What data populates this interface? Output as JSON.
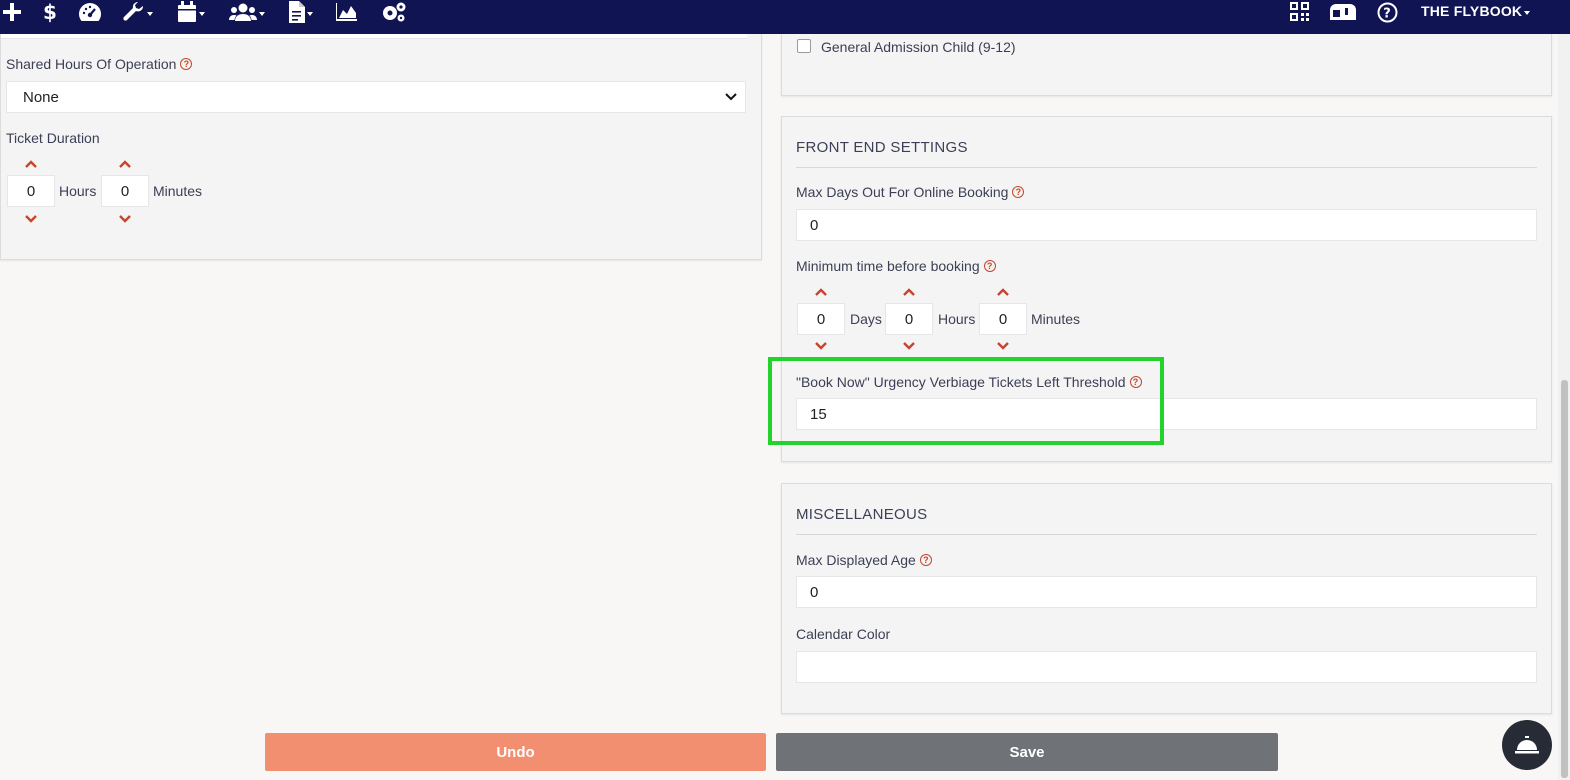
{
  "nav": {
    "brand": "THE FLYBOOK",
    "icons": [
      "plus-icon",
      "dollar-icon",
      "dashboard-icon",
      "wrench-icon",
      "calendar-icon",
      "users-icon",
      "document-icon",
      "chart-icon",
      "settings-icon",
      "qr-code-icon",
      "mailbox-icon",
      "help-icon"
    ]
  },
  "left_panel": {
    "shared_hours_label": "Shared Hours Of Operation",
    "shared_hours_value": "None",
    "ticket_duration_label": "Ticket Duration",
    "duration_hours": "0",
    "duration_hours_unit": "Hours",
    "duration_minutes": "0",
    "duration_minutes_unit": "Minutes"
  },
  "top_right_panel": {
    "checkbox_label": "General Admission Child (9-12)"
  },
  "front_end": {
    "title": "FRONT END SETTINGS",
    "max_days_label": "Max Days Out For Online Booking",
    "max_days_value": "0",
    "min_time_label": "Minimum time before booking",
    "min_days": "0",
    "min_days_unit": "Days",
    "min_hours": "0",
    "min_hours_unit": "Hours",
    "min_minutes": "0",
    "min_minutes_unit": "Minutes",
    "threshold_label": "\"Book Now\" Urgency Verbiage Tickets Left Threshold",
    "threshold_value": "15"
  },
  "misc": {
    "title": "MISCELLANEOUS",
    "max_age_label": "Max Displayed Age",
    "max_age_value": "0",
    "calendar_color_label": "Calendar Color",
    "calendar_color_value": ""
  },
  "actions": {
    "undo_label": "Undo",
    "save_label": "Save"
  },
  "help_glyph": "?",
  "colors": {
    "nav_bg": "#111453",
    "accent_red": "#c6452c",
    "undo_bg": "#f38f71",
    "save_bg": "#6f7378",
    "highlight": "#22d32c"
  }
}
